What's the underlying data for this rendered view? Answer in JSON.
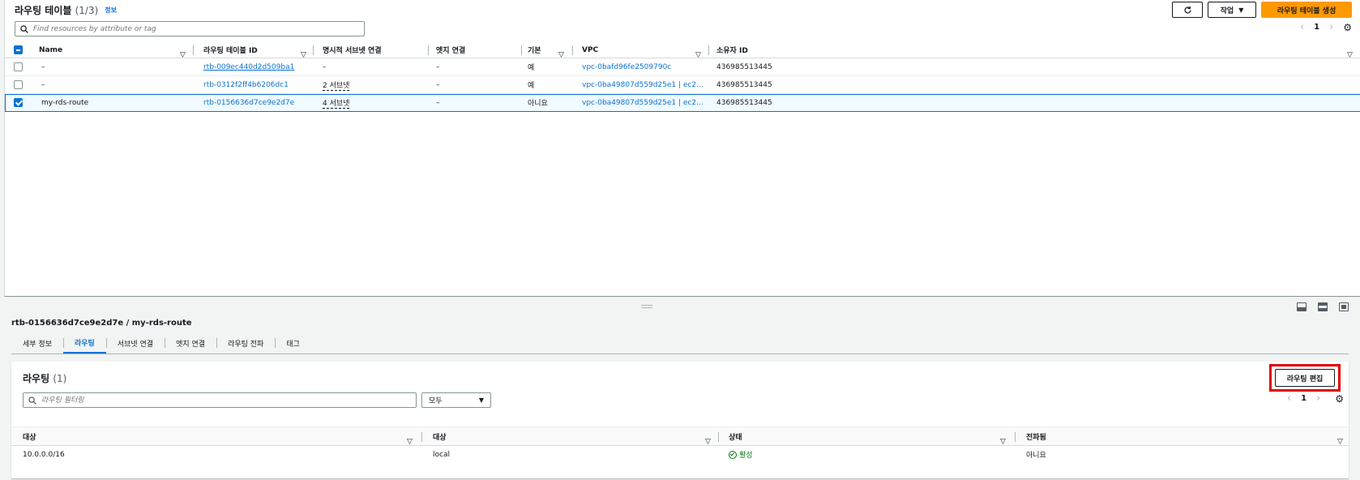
{
  "top": {
    "title": "라우팅 테이블",
    "count": "(1/3)",
    "info": "정보",
    "actions_label": "작업",
    "create_label": "라우팅 테이블 생성",
    "search_placeholder": "Find resources by attribute or tag",
    "page": "1",
    "columns": [
      "Name",
      "라우팅 테이블 ID",
      "명시적 서브넷 연결",
      "엣지 연결",
      "기본",
      "VPC",
      "소유자 ID"
    ],
    "rows": [
      {
        "name": "–",
        "rtb_id": "rtb-009ec440d2d509ba1",
        "subnet": "–",
        "edge": "–",
        "main": "예",
        "vpc": "vpc-0bafd96fe2509790c",
        "owner": "436985513445",
        "selected": false
      },
      {
        "name": "–",
        "rtb_id": "rtb-0312f2ff4b6206dc1",
        "subnet": "2 서브넷",
        "edge": "–",
        "main": "예",
        "vpc": "vpc-0ba49807d559d25e1 | ec2...",
        "owner": "436985513445",
        "selected": false
      },
      {
        "name": "my-rds-route",
        "rtb_id": "rtb-0156636d7ce9e2d7e",
        "subnet": "4 서브넷",
        "edge": "–",
        "main": "아니요",
        "vpc": "vpc-0ba49807d559d25e1 | ec2...",
        "owner": "436985513445",
        "selected": true
      }
    ]
  },
  "detail": {
    "title": "rtb-0156636d7ce9e2d7e / my-rds-route",
    "tabs": [
      "세부 정보",
      "라우팅",
      "서브넷 연결",
      "엣지 연결",
      "라우팅 전파",
      "태그"
    ],
    "active_tab": 1
  },
  "routes": {
    "title": "라우팅",
    "count": "(1)",
    "edit_label": "라우팅 편집",
    "filter_placeholder": "라우팅 필터링",
    "select_value": "모두",
    "page": "1",
    "columns": [
      "대상",
      "대상",
      "상태",
      "전파됨"
    ],
    "rows": [
      {
        "destination": "10.0.0.0/16",
        "target": "local",
        "status": "활성",
        "propagated": "아니요"
      }
    ]
  },
  "colors": {
    "accent": "#0972d3",
    "primary_button": "#ff9900",
    "highlight_box": "#e00000",
    "status_active": "#037f0c"
  }
}
